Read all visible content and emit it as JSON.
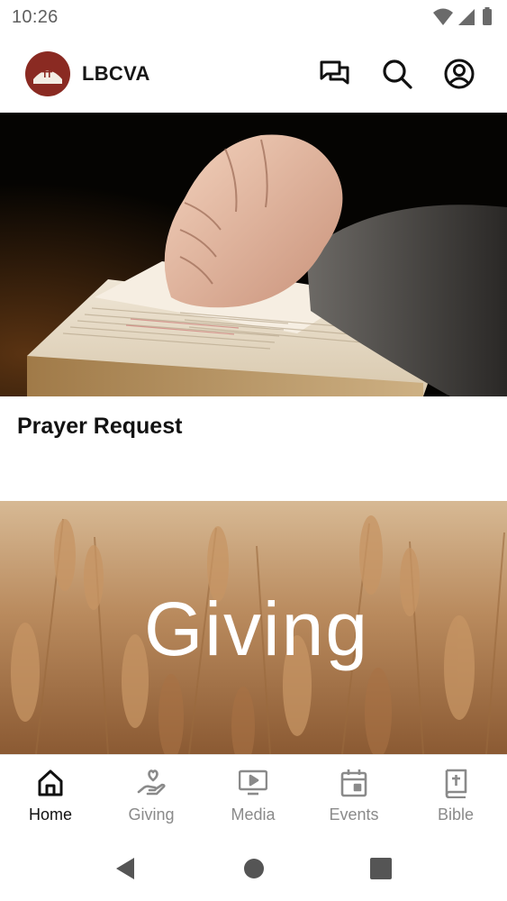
{
  "status_bar": {
    "time": "10:26",
    "icons": [
      "wifi-icon",
      "cell-signal-icon",
      "battery-icon"
    ]
  },
  "app_bar": {
    "title": "LBCVA",
    "actions": [
      "chat-icon",
      "search-icon",
      "account-icon"
    ]
  },
  "cards": [
    {
      "title": "Prayer Request",
      "image": "hands-praying-on-bible"
    },
    {
      "image_text": "Giving",
      "image": "wheat-field"
    }
  ],
  "bottom_nav": {
    "items": [
      {
        "label": "Home",
        "icon": "home-icon",
        "active": true
      },
      {
        "label": "Giving",
        "icon": "giving-hand-heart-icon",
        "active": false
      },
      {
        "label": "Media",
        "icon": "media-play-icon",
        "active": false
      },
      {
        "label": "Events",
        "icon": "calendar-icon",
        "active": false
      },
      {
        "label": "Bible",
        "icon": "bible-icon",
        "active": false
      }
    ]
  },
  "colors": {
    "brand": "#8a2a22",
    "active_nav": "#111111",
    "inactive_nav": "#8a8a8a"
  }
}
